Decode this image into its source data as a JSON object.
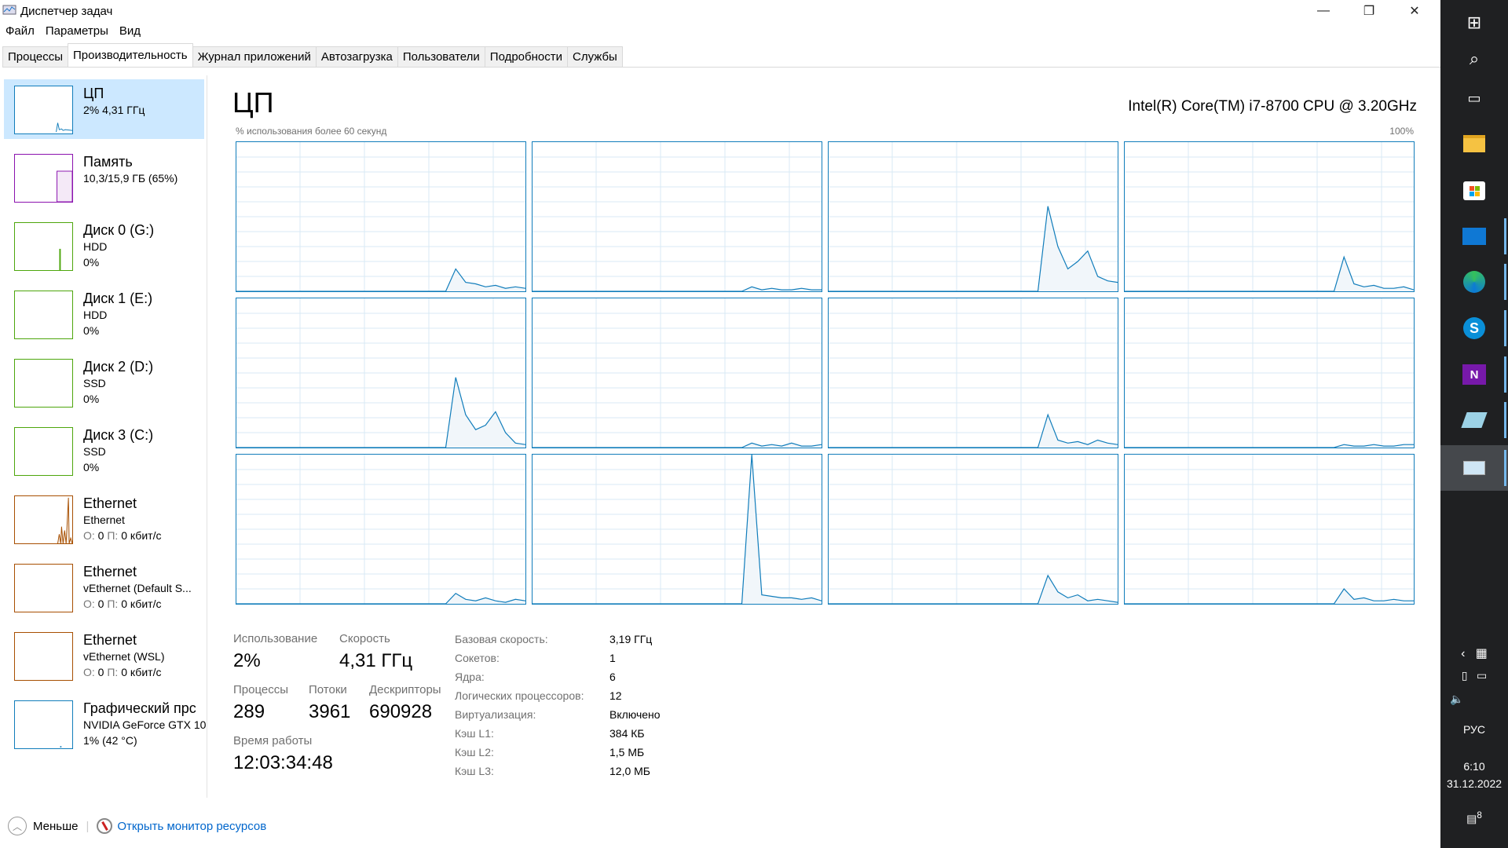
{
  "window": {
    "title": "Диспетчер задач",
    "minimize": "—",
    "maximize": "❐",
    "close": "✕"
  },
  "menu": [
    "Файл",
    "Параметры",
    "Вид"
  ],
  "tabs": [
    {
      "label": "Процессы"
    },
    {
      "label": "Производительность",
      "active": true
    },
    {
      "label": "Журнал приложений"
    },
    {
      "label": "Автозагрузка"
    },
    {
      "label": "Пользователи"
    },
    {
      "label": "Подробности"
    },
    {
      "label": "Службы"
    }
  ],
  "sidebar": [
    {
      "title": "ЦП",
      "l1": "2% 4,31 ГГц",
      "l2": "",
      "color": "#117dbb",
      "selected": true
    },
    {
      "title": "Память",
      "l1": "10,3/15,9 ГБ (65%)",
      "l2": "",
      "color": "#8b12ae",
      "fill": 65
    },
    {
      "title": "Диск 0 (G:)",
      "l1": "HDD",
      "l2": "0%",
      "color": "#4da60c"
    },
    {
      "title": "Диск 1 (E:)",
      "l1": "HDD",
      "l2": "0%",
      "color": "#4da60c"
    },
    {
      "title": "Диск 2 (D:)",
      "l1": "SSD",
      "l2": "0%",
      "color": "#4da60c"
    },
    {
      "title": "Диск 3 (C:)",
      "l1": "SSD",
      "l2": "0%",
      "color": "#4da60c"
    },
    {
      "title": "Ethernet",
      "l1": "Ethernet",
      "l2a": "О:",
      "l2b": "0",
      "l2c": "П:",
      "l2d": "0 кбит/с",
      "color": "#a74f01"
    },
    {
      "title": "Ethernet",
      "l1": "vEthernet (Default S...",
      "l2a": "О:",
      "l2b": "0",
      "l2c": "П:",
      "l2d": "0 кбит/с",
      "color": "#a74f01"
    },
    {
      "title": "Ethernet",
      "l1": "vEthernet (WSL)",
      "l2a": "О:",
      "l2b": "0",
      "l2c": "П:",
      "l2d": "0 кбит/с",
      "color": "#a74f01"
    },
    {
      "title": "Графический прс",
      "l1": "NVIDIA GeForce GTX 10",
      "l2": "1% (42 °C)",
      "color": "#117dbb"
    }
  ],
  "main": {
    "title": "ЦП",
    "cpu_name": "Intel(R) Core(TM) i7-8700 CPU @ 3.20GHz",
    "subtitle": "% использования более 60 секунд",
    "max_label": "100%"
  },
  "chart_data": {
    "type": "area",
    "title": "% использования более 60 секунд",
    "ylim": [
      0,
      100
    ],
    "xlim_seconds": [
      60,
      0
    ],
    "grid": true,
    "color": "#117dbb",
    "cores": [
      [
        0,
        0,
        0,
        0,
        0,
        0,
        0,
        0,
        0,
        0,
        0,
        0,
        0,
        0,
        0,
        0,
        0,
        0,
        0,
        0,
        0,
        0,
        15,
        6,
        5,
        3,
        4,
        2,
        3,
        2
      ],
      [
        0,
        0,
        0,
        0,
        0,
        0,
        0,
        0,
        0,
        0,
        0,
        0,
        0,
        0,
        0,
        0,
        0,
        0,
        0,
        0,
        0,
        0,
        3,
        1,
        2,
        1,
        1,
        2,
        1,
        1
      ],
      [
        0,
        0,
        0,
        0,
        0,
        0,
        0,
        0,
        0,
        0,
        0,
        0,
        0,
        0,
        0,
        0,
        0,
        0,
        0,
        0,
        0,
        0,
        57,
        30,
        15,
        20,
        27,
        10,
        7,
        6
      ],
      [
        0,
        0,
        0,
        0,
        0,
        0,
        0,
        0,
        0,
        0,
        0,
        0,
        0,
        0,
        0,
        0,
        0,
        0,
        0,
        0,
        0,
        0,
        23,
        5,
        3,
        4,
        2,
        2,
        3,
        1
      ],
      [
        0,
        0,
        0,
        0,
        0,
        0,
        0,
        0,
        0,
        0,
        0,
        0,
        0,
        0,
        0,
        0,
        0,
        0,
        0,
        0,
        0,
        0,
        47,
        22,
        12,
        15,
        24,
        10,
        3,
        2
      ],
      [
        0,
        0,
        0,
        0,
        0,
        0,
        0,
        0,
        0,
        0,
        0,
        0,
        0,
        0,
        0,
        0,
        0,
        0,
        0,
        0,
        0,
        0,
        3,
        1,
        2,
        1,
        3,
        1,
        1,
        2
      ],
      [
        0,
        0,
        0,
        0,
        0,
        0,
        0,
        0,
        0,
        0,
        0,
        0,
        0,
        0,
        0,
        0,
        0,
        0,
        0,
        0,
        0,
        0,
        22,
        5,
        3,
        4,
        2,
        5,
        3,
        2
      ],
      [
        0,
        0,
        0,
        0,
        0,
        0,
        0,
        0,
        0,
        0,
        0,
        0,
        0,
        0,
        0,
        0,
        0,
        0,
        0,
        0,
        0,
        0,
        2,
        1,
        1,
        2,
        1,
        1,
        2,
        2
      ],
      [
        0,
        0,
        0,
        0,
        0,
        0,
        0,
        0,
        0,
        0,
        0,
        0,
        0,
        0,
        0,
        0,
        0,
        0,
        0,
        0,
        0,
        0,
        7,
        3,
        2,
        4,
        2,
        1,
        3,
        2
      ],
      [
        0,
        0,
        0,
        0,
        0,
        0,
        0,
        0,
        0,
        0,
        0,
        0,
        0,
        0,
        0,
        0,
        0,
        0,
        0,
        0,
        0,
        0,
        100,
        6,
        5,
        4,
        4,
        3,
        4,
        2
      ],
      [
        0,
        0,
        0,
        0,
        0,
        0,
        0,
        0,
        0,
        0,
        0,
        0,
        0,
        0,
        0,
        0,
        0,
        0,
        0,
        0,
        0,
        0,
        19,
        8,
        4,
        6,
        2,
        3,
        2,
        1
      ],
      [
        0,
        0,
        0,
        0,
        0,
        0,
        0,
        0,
        0,
        0,
        0,
        0,
        0,
        0,
        0,
        0,
        0,
        0,
        0,
        0,
        0,
        0,
        10,
        3,
        4,
        2,
        2,
        3,
        2,
        2
      ]
    ]
  },
  "stats": {
    "usage_label": "Использование",
    "usage": "2%",
    "speed_label": "Скорость",
    "speed": "4,31 ГГц",
    "proc_label": "Процессы",
    "proc": "289",
    "threads_label": "Потоки",
    "threads": "3961",
    "handles_label": "Дескрипторы",
    "handles": "690928",
    "uptime_label": "Время работы",
    "uptime": "12:03:34:48"
  },
  "info": [
    [
      "Базовая скорость:",
      "3,19 ГГц"
    ],
    [
      "Сокетов:",
      "1"
    ],
    [
      "Ядра:",
      "6"
    ],
    [
      "Логических процессоров:",
      "12"
    ],
    [
      "Виртуализация:",
      "Включено"
    ],
    [
      "Кэш L1:",
      "384 КБ"
    ],
    [
      "Кэш L2:",
      "1,5 МБ"
    ],
    [
      "Кэш L3:",
      "12,0 МБ"
    ]
  ],
  "bottom": {
    "fewer": "Меньше",
    "resmon": "Открыть монитор ресурсов"
  },
  "taskbar": {
    "lang": "РУС",
    "time": "6:10",
    "date": "31.12.2022",
    "notifications": "8",
    "icons": [
      "windows-start",
      "search",
      "task-view",
      "file-explorer",
      "microsoft-store",
      "mail",
      "edge",
      "skype",
      "onenote",
      "notepad",
      "task-manager"
    ]
  }
}
